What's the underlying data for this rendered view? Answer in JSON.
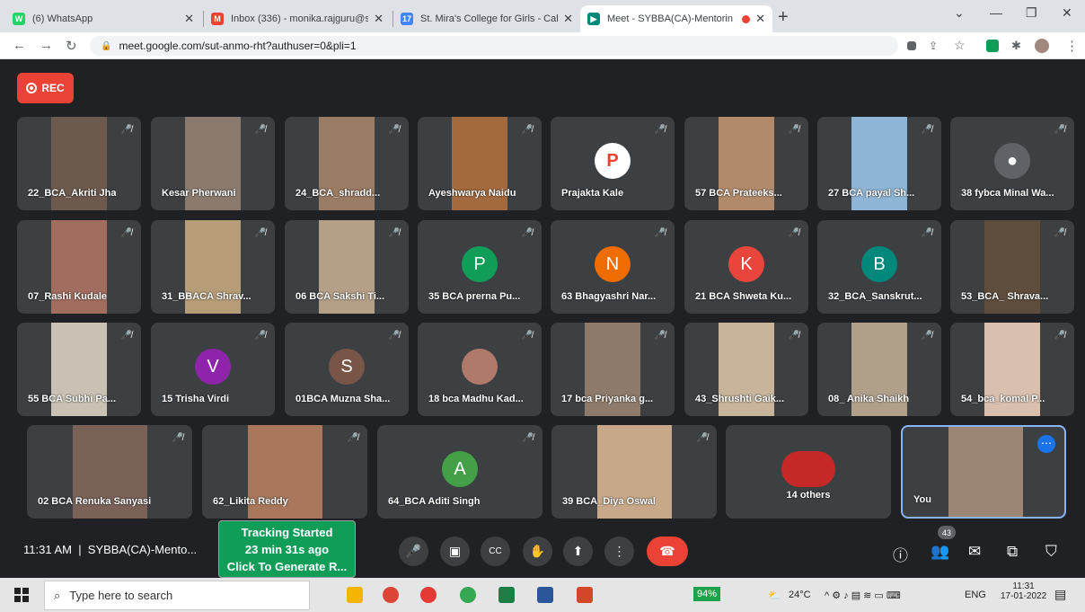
{
  "tabs": [
    {
      "title": "(6) WhatsApp",
      "color": "#25d366",
      "glyph": "W"
    },
    {
      "title": "Inbox (336) - monika.rajguru@st",
      "color": "#ea4335",
      "glyph": "M"
    },
    {
      "title": "St. Mira's College for Girls - Caler",
      "color": "#4285f4",
      "glyph": "17"
    },
    {
      "title": "Meet - SYBBA(CA)-Mentorin",
      "color": "#00897b",
      "glyph": "▶"
    }
  ],
  "url": "meet.google.com/sut-anmo-rht?authuser=0&pli=1",
  "rec_label": "REC",
  "participants": [
    {
      "name": "22_BCA_Akriti Jha",
      "type": "video",
      "vc": "#6d5a4e"
    },
    {
      "name": "Kesar Pherwani",
      "type": "video",
      "vc": "#8a7a6e"
    },
    {
      "name": "24_BCA_shradd...",
      "type": "video",
      "vc": "#9a7b64"
    },
    {
      "name": "Ayeshwarya Naidu",
      "type": "video",
      "vc": "#a36a3f"
    },
    {
      "name": "Prajakta Kale",
      "type": "logo",
      "av": "#fff"
    },
    {
      "name": "57 BCA Prateeks...",
      "type": "video",
      "vc": "#b08a6a"
    },
    {
      "name": "27 BCA payal Sh...",
      "type": "video",
      "vc": "#8fb5d6"
    },
    {
      "name": "38 fybca Minal Wa...",
      "type": "avatar",
      "letter": "●",
      "av": "#5f6368"
    },
    {
      "name": "07_Rashi Kudale",
      "type": "video",
      "vc": "#a06d5e"
    },
    {
      "name": "31_BBACA Shrav...",
      "type": "video",
      "vc": "#b79d77"
    },
    {
      "name": "06 BCA Sakshi Ti...",
      "type": "video",
      "vc": "#b49f87"
    },
    {
      "name": "35 BCA prerna Pu...",
      "type": "avatar",
      "letter": "P",
      "av": "#0f9d58"
    },
    {
      "name": "63 Bhagyashri Nar...",
      "type": "avatar",
      "letter": "N",
      "av": "#ef6c00"
    },
    {
      "name": "21 BCA Shweta Ku...",
      "type": "avatar",
      "letter": "K",
      "av": "#e8453c"
    },
    {
      "name": "32_BCA_Sanskrut...",
      "type": "avatar",
      "letter": "B",
      "av": "#00897b"
    },
    {
      "name": "53_BCA_ Shrava...",
      "type": "video",
      "vc": "#5e4d3c"
    },
    {
      "name": "55 BCA Subhi Pa...",
      "type": "video",
      "vc": "#c9c1b3"
    },
    {
      "name": "15 Trisha Virdi",
      "type": "avatar",
      "letter": "V",
      "av": "#8e24aa"
    },
    {
      "name": "01BCA Muzna Sha...",
      "type": "avatar",
      "letter": "S",
      "av": "#795548"
    },
    {
      "name": "18 bca Madhu Kad...",
      "type": "photo",
      "av": "#b07a6a"
    },
    {
      "name": "17 bca Priyanka g...",
      "type": "video",
      "vc": "#8e7a6a"
    },
    {
      "name": "43_Shrushti Gaik...",
      "type": "video",
      "vc": "#c7b49a"
    },
    {
      "name": "08_ Anika Shaikh",
      "type": "video",
      "vc": "#b0a089"
    },
    {
      "name": "54_bca_komal P...",
      "type": "video",
      "vc": "#d9bfae"
    },
    {
      "name": "02 BCA Renuka Sanyasi",
      "type": "video",
      "vc": "#7a6258"
    },
    {
      "name": "62_Likita Reddy",
      "type": "video",
      "vc": "#a8775c"
    },
    {
      "name": "64_BCA Aditi Singh",
      "type": "avatar",
      "letter": "A",
      "av": "#43a047"
    },
    {
      "name": "39 BCA_Diya Oswal",
      "type": "video",
      "vc": "#c7a98a"
    },
    {
      "name": "14 others",
      "type": "others"
    },
    {
      "name": "You",
      "type": "video",
      "vc": "#9d8575"
    }
  ],
  "time": "11:31 AM",
  "meeting": "SYBBA(CA)-Mento...",
  "tracking": [
    "Tracking Started",
    "23 min 31s ago",
    "Click To Generate R..."
  ],
  "people_count": "43",
  "taskbar": {
    "search": "Type here to search",
    "battery": "94%",
    "weather": "24°C",
    "lang": "ENG",
    "clock": "11:31",
    "date": "17-01-2022"
  }
}
